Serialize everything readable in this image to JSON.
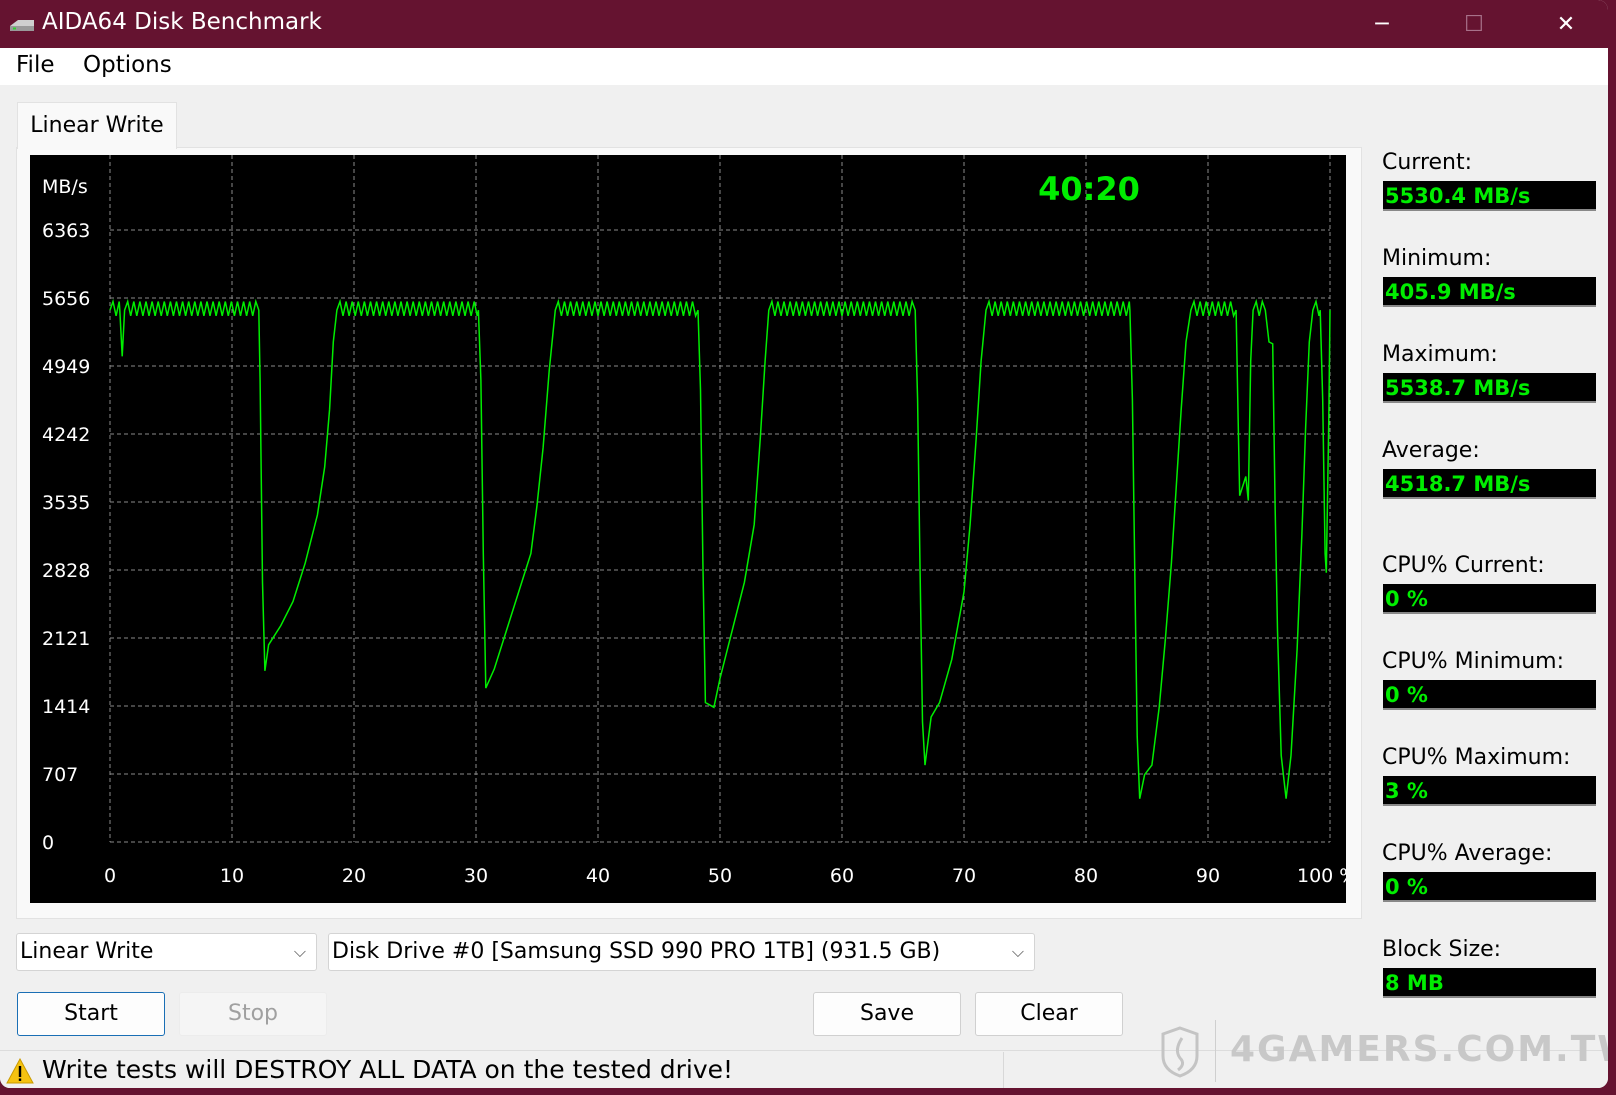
{
  "window": {
    "title": "AIDA64 Disk Benchmark",
    "title_icon": "disk-drive-icon",
    "controls": {
      "minimize": "─",
      "maximize": "☐",
      "close": "✕"
    }
  },
  "menu": {
    "items": [
      {
        "label": "File"
      },
      {
        "label": "Options"
      }
    ]
  },
  "tab": {
    "label": "Linear Write"
  },
  "timer": "40:20",
  "stats": [
    {
      "label": "Current:",
      "value": "5530.4 MB/s"
    },
    {
      "label": "Minimum:",
      "value": "405.9 MB/s"
    },
    {
      "label": "Maximum:",
      "value": "5538.7 MB/s"
    },
    {
      "label": "Average:",
      "value": "4518.7 MB/s"
    },
    {
      "label": "CPU% Current:",
      "value": "0 %"
    },
    {
      "label": "CPU% Minimum:",
      "value": "0 %"
    },
    {
      "label": "CPU% Maximum:",
      "value": "3 %"
    },
    {
      "label": "CPU% Average:",
      "value": "0 %"
    },
    {
      "label": "Block Size:",
      "value": "8 MB"
    }
  ],
  "controls": {
    "test_select": "Linear Write",
    "drive_select": "Disk Drive #0  [Samsung SSD 990 PRO 1TB]  (931.5 GB)",
    "start": "Start",
    "stop": "Stop",
    "save": "Save",
    "clear": "Clear"
  },
  "status": {
    "warning": "Write tests will DESTROY ALL DATA on the tested drive!",
    "icon": "warning-icon"
  },
  "watermark": "4GAMERS.COM.TW",
  "colors": {
    "titlebar": "#651330",
    "trace": "#00ee00",
    "chart_bg": "#000000",
    "grid": "#8a8a8a"
  },
  "chart_data": {
    "type": "line",
    "title": "",
    "ylabel": "MB/s",
    "xlabel": "%",
    "ylim": [
      0,
      6363
    ],
    "xlim": [
      0,
      100
    ],
    "grid": true,
    "y_ticks": [
      0,
      707,
      1414,
      2121,
      2828,
      3535,
      4242,
      4949,
      5656,
      6363
    ],
    "x_ticks": [
      0,
      10,
      20,
      30,
      40,
      50,
      60,
      70,
      80,
      90,
      100
    ],
    "x_tick_labels": [
      "0",
      "10",
      "20",
      "30",
      "40",
      "50",
      "60",
      "70",
      "80",
      "90",
      "100 %"
    ],
    "series": [
      {
        "name": "Linear Write",
        "plateau_mbps": 5530,
        "points": [
          [
            0,
            5530
          ],
          [
            0.8,
            5530
          ],
          [
            1.0,
            5050
          ],
          [
            1.2,
            5530
          ],
          [
            12.2,
            5530
          ],
          [
            12.3,
            4800
          ],
          [
            12.5,
            2700
          ],
          [
            12.7,
            1780
          ],
          [
            13.0,
            2050
          ],
          [
            14.0,
            2250
          ],
          [
            15.0,
            2500
          ],
          [
            16.0,
            2900
          ],
          [
            17.0,
            3400
          ],
          [
            17.6,
            3900
          ],
          [
            18.0,
            4500
          ],
          [
            18.3,
            5200
          ],
          [
            18.6,
            5530
          ],
          [
            30.2,
            5530
          ],
          [
            30.4,
            4800
          ],
          [
            30.6,
            3000
          ],
          [
            30.8,
            1600
          ],
          [
            31.5,
            1800
          ],
          [
            32.5,
            2200
          ],
          [
            33.5,
            2600
          ],
          [
            34.5,
            3000
          ],
          [
            35.0,
            3500
          ],
          [
            35.5,
            4100
          ],
          [
            36.0,
            4900
          ],
          [
            36.5,
            5530
          ],
          [
            48.2,
            5530
          ],
          [
            48.4,
            4700
          ],
          [
            48.6,
            2900
          ],
          [
            48.8,
            1450
          ],
          [
            49.5,
            1400
          ],
          [
            50.0,
            1700
          ],
          [
            51.0,
            2200
          ],
          [
            52.0,
            2700
          ],
          [
            52.8,
            3300
          ],
          [
            53.3,
            4200
          ],
          [
            53.7,
            5000
          ],
          [
            54.0,
            5530
          ],
          [
            66.0,
            5530
          ],
          [
            66.2,
            4600
          ],
          [
            66.4,
            2800
          ],
          [
            66.6,
            1250
          ],
          [
            66.8,
            800
          ],
          [
            67.3,
            1300
          ],
          [
            68.0,
            1450
          ],
          [
            69.0,
            1900
          ],
          [
            70.0,
            2600
          ],
          [
            70.5,
            3300
          ],
          [
            71.0,
            4200
          ],
          [
            71.4,
            5000
          ],
          [
            71.8,
            5530
          ],
          [
            83.6,
            5530
          ],
          [
            83.8,
            4600
          ],
          [
            84.0,
            2800
          ],
          [
            84.2,
            1100
          ],
          [
            84.4,
            450
          ],
          [
            84.8,
            700
          ],
          [
            85.4,
            800
          ],
          [
            86.0,
            1400
          ],
          [
            86.5,
            2100
          ],
          [
            87.0,
            2900
          ],
          [
            87.4,
            3700
          ],
          [
            87.8,
            4500
          ],
          [
            88.2,
            5200
          ],
          [
            88.6,
            5530
          ],
          [
            92.3,
            5530
          ],
          [
            92.5,
            4200
          ],
          [
            92.6,
            3600
          ],
          [
            93.1,
            3800
          ],
          [
            93.3,
            3550
          ],
          [
            93.5,
            5000
          ],
          [
            93.7,
            5530
          ],
          [
            94.7,
            5530
          ],
          [
            95.0,
            5200
          ],
          [
            95.3,
            5180
          ],
          [
            95.5,
            3500
          ],
          [
            95.7,
            2200
          ],
          [
            96.0,
            900
          ],
          [
            96.4,
            450
          ],
          [
            96.8,
            900
          ],
          [
            97.3,
            2000
          ],
          [
            97.7,
            3200
          ],
          [
            98.0,
            4300
          ],
          [
            98.3,
            5200
          ],
          [
            98.6,
            5530
          ],
          [
            99.2,
            5530
          ],
          [
            99.4,
            4600
          ],
          [
            99.6,
            3000
          ],
          [
            99.7,
            2800
          ],
          [
            99.9,
            4400
          ],
          [
            100,
            5530
          ]
        ]
      }
    ]
  }
}
